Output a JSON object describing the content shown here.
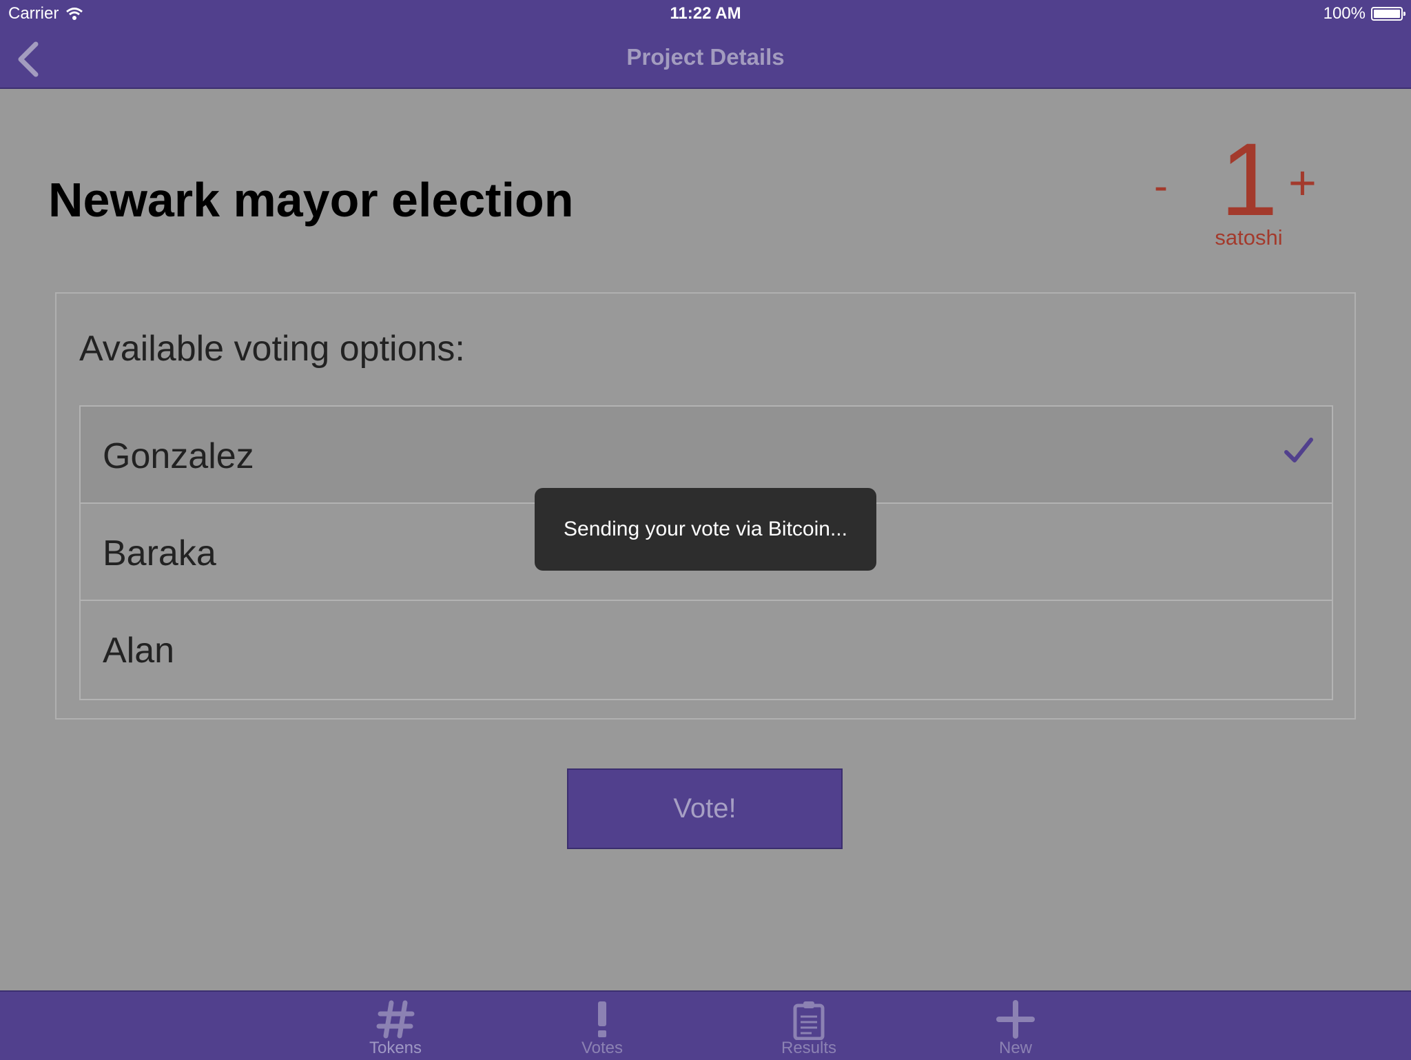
{
  "status_bar": {
    "carrier": "Carrier",
    "time": "11:22 AM",
    "battery": "100%"
  },
  "nav": {
    "title": "Project Details"
  },
  "project": {
    "title": "Newark mayor election"
  },
  "stepper": {
    "minus": "-",
    "value": "1",
    "plus": "+",
    "unit": "satoshi"
  },
  "voting": {
    "heading": "Available voting options:",
    "options": [
      {
        "label": "Gonzalez",
        "selected": true
      },
      {
        "label": "Baraka",
        "selected": false
      },
      {
        "label": "Alan",
        "selected": false
      }
    ]
  },
  "vote_button": "Vote!",
  "toast": "Sending your vote via Bitcoin...",
  "tabs": [
    {
      "label": "Tokens",
      "icon": "hash-icon"
    },
    {
      "label": "Votes",
      "icon": "exclamation-icon"
    },
    {
      "label": "Results",
      "icon": "clipboard-icon"
    },
    {
      "label": "New",
      "icon": "plus-icon"
    }
  ],
  "colors": {
    "accent": "#51408d",
    "stepper": "#a33a2c",
    "background": "#999999"
  }
}
